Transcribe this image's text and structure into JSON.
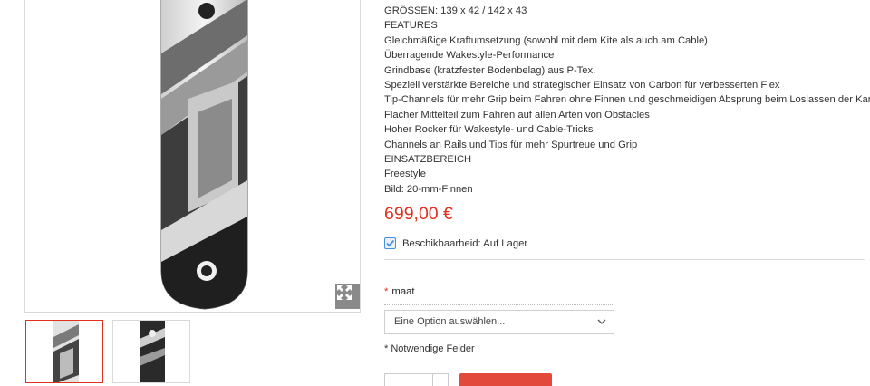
{
  "product": {
    "description_lines": [
      "GRÖSSEN: 139 x 42 / 142 x 43",
      "FEATURES",
      "Gleichmäßige Kraftumsetzung (sowohl mit dem Kite als auch am Cable)",
      "Überragende Wakestyle-Performance",
      "Grindbase (kratzfester Bodenbelag) aus P-Tex.",
      "Speziell verstärkte Bereiche und strategischer Einsatz von Carbon für verbesserten Flex",
      "Tip-Channels für mehr Grip beim Fahren ohne Finnen und geschmeidigen Absprung beim Loslassen der Kante",
      "Flacher Mittelteil zum Fahren auf allen Arten von Obstacles",
      "Hoher Rocker für Wakestyle- und Cable-Tricks",
      "Channels an Rails und Tips für mehr Spurtreue und Grip",
      "EINSATZBEREICH",
      "Freestyle",
      "Bild: 20-mm-Finnen"
    ],
    "price": "699,00 €",
    "availability": "Beschikbaarheid: Auf Lager"
  },
  "options": {
    "required_marker": "*",
    "size_label": "maat",
    "select_placeholder": "Eine Option auswählen...",
    "required_note": "* Notwendige Felder"
  },
  "gallery": {
    "icons": [
      "expand-icon",
      "checkbox-checked-icon",
      "chevron-down-icon"
    ],
    "thumbnail_count": 2
  },
  "colors": {
    "price": "#e22f1e",
    "accent_button": "#e2493b",
    "check": "#4a90d9"
  }
}
